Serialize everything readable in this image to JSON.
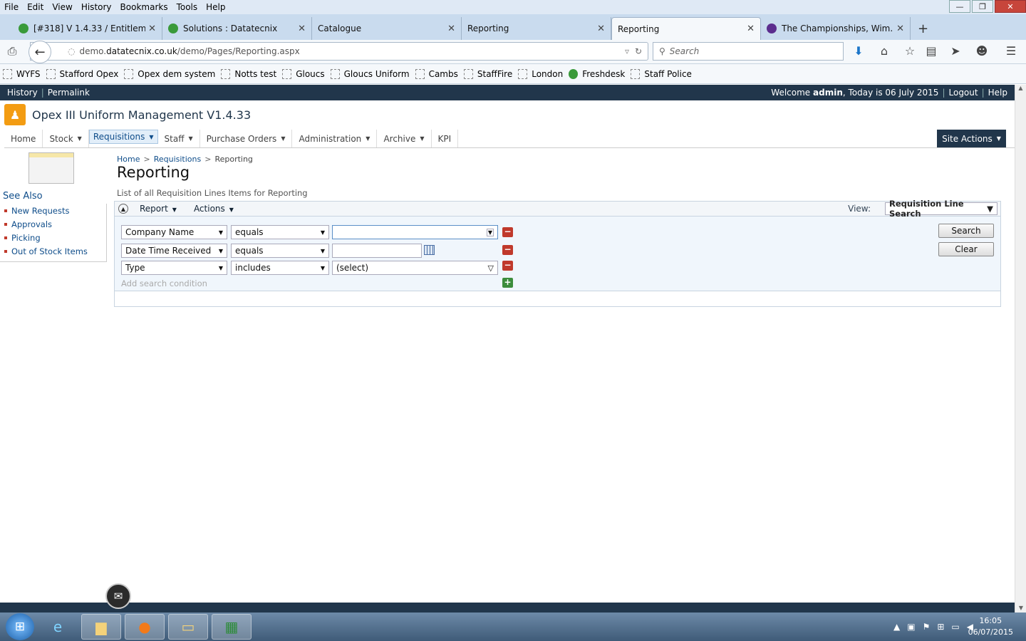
{
  "browser": {
    "menu": [
      "File",
      "Edit",
      "View",
      "History",
      "Bookmarks",
      "Tools",
      "Help"
    ],
    "tabs": [
      {
        "label": "[#318] V 1.4.33 / Entitleme...",
        "favicon_color": "#3a9a3a"
      },
      {
        "label": "Solutions : Datatecnix",
        "favicon_color": "#3a9a3a"
      },
      {
        "label": "Catalogue",
        "favicon_color": ""
      },
      {
        "label": "Reporting",
        "favicon_color": ""
      },
      {
        "label": "Reporting",
        "favicon_color": "",
        "active": true
      },
      {
        "label": "The Championships, Wim...",
        "favicon_color": "#5b2d8e"
      }
    ],
    "new_tab": "+",
    "url_host": "demo.",
    "url_domain": "datatecnix.co.uk",
    "url_path": "/demo/Pages/Reporting.aspx",
    "search_placeholder": "Search",
    "bookmarks": [
      "WYFS",
      "Stafford Opex",
      "Opex dem system",
      "Notts test",
      "Gloucs",
      "Gloucs Uniform",
      "Cambs",
      "StaffFire",
      "London",
      "Freshdesk",
      "Staff Police"
    ]
  },
  "site": {
    "top_left": {
      "history": "History",
      "permalink": "Permalink"
    },
    "welcome_prefix": "Welcome ",
    "user": "admin",
    "date_text": ", Today is 06 July 2015",
    "logout": "Logout",
    "help": "Help",
    "title": "Opex III Uniform Management V1.4.33",
    "nav": [
      {
        "label": "Home",
        "caret": false
      },
      {
        "label": "Stock",
        "caret": true
      },
      {
        "label": "Requisitions",
        "caret": true,
        "selected": true
      },
      {
        "label": "Staff",
        "caret": true
      },
      {
        "label": "Purchase Orders",
        "caret": true
      },
      {
        "label": "Administration",
        "caret": true
      },
      {
        "label": "Archive",
        "caret": true
      },
      {
        "label": "KPI",
        "caret": false
      }
    ],
    "site_actions": "Site Actions"
  },
  "sidebar": {
    "see_also": "See Also",
    "links": [
      "New Requests",
      "Approvals",
      "Picking",
      "Out of Stock Items"
    ]
  },
  "page": {
    "breadcrumb": [
      "Home",
      "Requisitions",
      "Reporting"
    ],
    "title": "Reporting",
    "description": "List of all Requisition Lines Items for Reporting",
    "toolbar": {
      "report": "Report",
      "actions": "Actions",
      "view_label": "View:",
      "view_value": "Requisition Line Search"
    },
    "conditions": [
      {
        "field": "Company Name",
        "operator": "equals",
        "value": ""
      },
      {
        "field": "Date Time Received",
        "operator": "equals",
        "value": ""
      },
      {
        "field": "Type",
        "operator": "includes",
        "value": "(select)"
      }
    ],
    "add_condition": "Add search condition",
    "search_button": "Search",
    "clear_button": "Clear"
  },
  "taskbar": {
    "time": "16:05",
    "date": "06/07/2015"
  }
}
